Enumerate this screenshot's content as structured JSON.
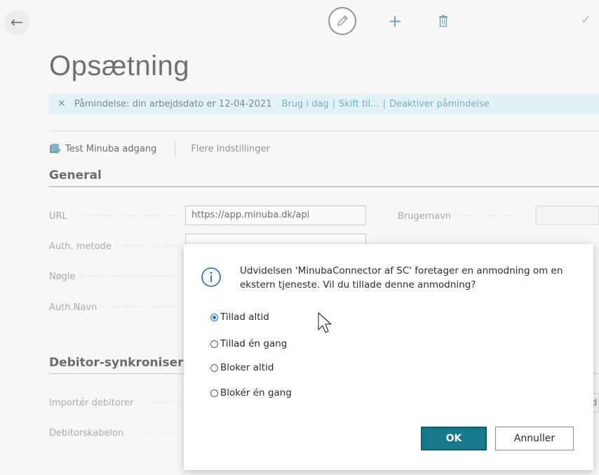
{
  "header": {
    "back_icon": "arrow-left-icon",
    "edit_icon": "pencil-icon",
    "add_icon": "plus-icon",
    "delete_icon": "trash-icon",
    "check_icon": "check-icon",
    "add_glyph": "+",
    "check_glyph": "✓",
    "back_glyph": "←"
  },
  "page": {
    "title": "Opsætning"
  },
  "notification": {
    "close_glyph": "✕",
    "text": "Påmindelse: din arbejdsdato er 12-04-2021",
    "links": [
      "Brug i dag",
      "Skift til...",
      "Deaktiver påmindelse"
    ],
    "separator": "|"
  },
  "actions": {
    "test_label": "Test Minuba adgang",
    "more_label": "Flere indstillinger"
  },
  "general": {
    "heading": "General",
    "fields": [
      {
        "label": "URL",
        "value": "https://app.minuba.dk/api"
      },
      {
        "label": "Auth. metode",
        "value": ""
      },
      {
        "label": "Nøgle",
        "value": ""
      },
      {
        "label": "Auth.Navn",
        "value": ""
      }
    ],
    "right_fields": [
      {
        "label": "Brugernavn",
        "value": ""
      }
    ]
  },
  "debitor": {
    "heading": "Debitor-synkronisering",
    "fields": [
      {
        "label": "Importér debitorer"
      },
      {
        "label": "Debitorskabelon"
      }
    ],
    "right_partial_value": "d"
  },
  "dialog": {
    "message": "Udvidelsen 'MinubaConnector af SC' foretager en anmodning om en ekstern tjeneste. Vil du tillade denne anmodning?",
    "options": [
      {
        "label": "Tillad altid",
        "checked": true
      },
      {
        "label": "Tillad én gang",
        "checked": false
      },
      {
        "label": "Bloker altid",
        "checked": false
      },
      {
        "label": "Blokér én gang",
        "checked": false
      }
    ],
    "ok_label": "OK",
    "cancel_label": "Annuller"
  },
  "colors": {
    "accent": "#167a8c",
    "banner_bg": "#d8eef3",
    "link": "#3c90ae",
    "radio_checked": "#1e6fd9"
  }
}
